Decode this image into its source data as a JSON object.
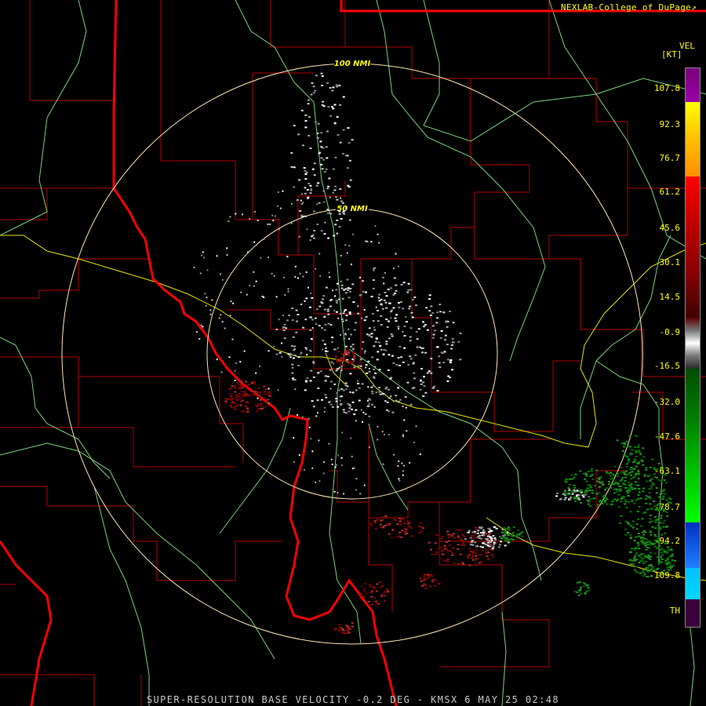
{
  "credit": "NEXLAB-College of DuPage",
  "credit_icon": "external-link-icon",
  "product_footer": "SUPER-RESOLUTION BASE VELOCITY -0.2 DEG - KMSX 6 MAY 25 02:48",
  "rings": [
    {
      "label": "100 NMI"
    },
    {
      "label": "50 NMI"
    }
  ],
  "legend": {
    "title": "VEL",
    "unit": "[KT]",
    "ticks": [
      "107.8",
      "92.3",
      "76.7",
      "61.2",
      "45.6",
      "30.1",
      "14.5",
      "-0.9",
      "-16.5",
      "-32.0",
      "-47.6",
      "-63.1",
      "-78.7",
      "-94.2",
      "-109.8",
      "TH"
    ],
    "stops": [
      {
        "value": 107.8,
        "color": "#800080"
      },
      {
        "value": 92.3,
        "color": "#ffff00"
      },
      {
        "value": 76.7,
        "color": "#ffa500"
      },
      {
        "value": 61.2,
        "color": "#ff0000"
      },
      {
        "value": 30.1,
        "color": "#8b0000"
      },
      {
        "value": -0.9,
        "color": "#ffffff"
      },
      {
        "value": -16.5,
        "color": "#006400"
      },
      {
        "value": -78.7,
        "color": "#00ff00"
      },
      {
        "value": -94.2,
        "color": "#0000ff"
      },
      {
        "value": -109.8,
        "color": "#00bfff"
      },
      {
        "value": "TH",
        "color": "#400040"
      }
    ]
  },
  "colors": {
    "background": "#000000",
    "state_border": "#ff0000",
    "county_border": "#b40000",
    "highway": "#7bd17b",
    "interstate": "#e6e600",
    "range_ring": "#ffe4b5"
  }
}
